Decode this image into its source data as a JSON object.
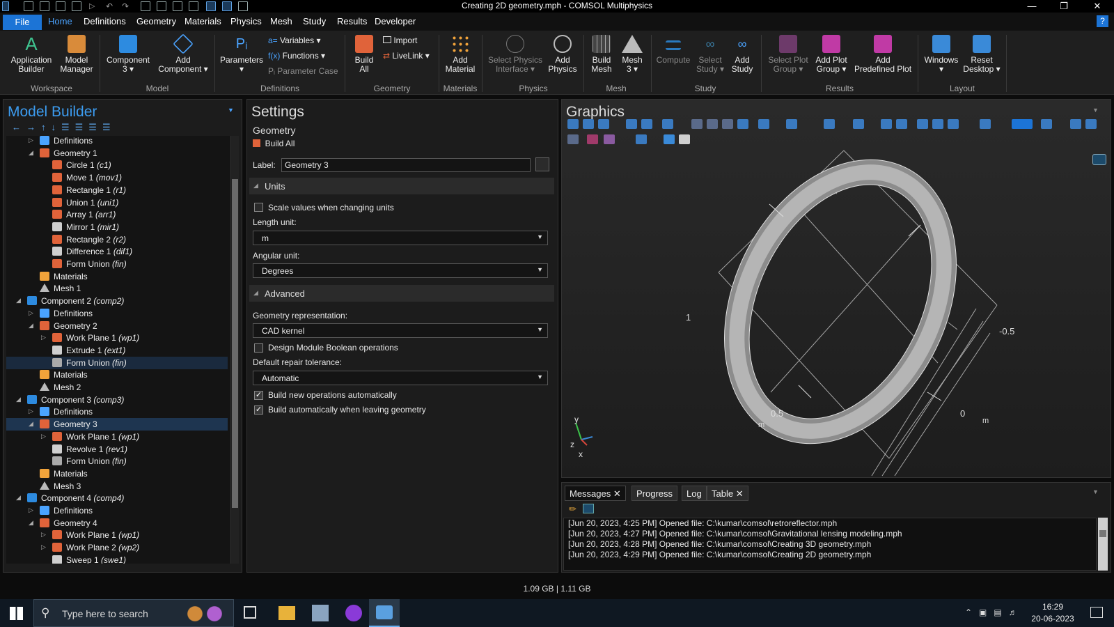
{
  "window": {
    "title": "Creating 2D geometry.mph - COMSOL Multiphysics",
    "min": "—",
    "max": "❐",
    "close": "✕"
  },
  "menu": {
    "file": "File",
    "tabs": [
      "Home",
      "Definitions",
      "Geometry",
      "Materials",
      "Physics",
      "Mesh",
      "Study",
      "Results",
      "Developer"
    ],
    "help": "?"
  },
  "ribbon": {
    "app_builder": [
      "Application",
      "Builder"
    ],
    "model_manager": [
      "Model",
      "Manager"
    ],
    "component": [
      "Component",
      "3 ▾"
    ],
    "add_component": [
      "Add",
      "Component ▾"
    ],
    "parameters": [
      "Parameters",
      "▾"
    ],
    "variables": "Variables ▾",
    "functions": "Functions ▾",
    "parameter_case": "Parameter Case",
    "build_all": [
      "Build",
      "All"
    ],
    "import": "Import",
    "livelink": "LiveLink ▾",
    "add_material": [
      "Add",
      "Material"
    ],
    "select_physics": [
      "Select Physics",
      "Interface ▾"
    ],
    "add_physics": [
      "Add",
      "Physics"
    ],
    "build_mesh": [
      "Build",
      "Mesh"
    ],
    "mesh": [
      "Mesh",
      "3 ▾"
    ],
    "compute": "Compute",
    "select_study": [
      "Select",
      "Study ▾"
    ],
    "add_study": [
      "Add",
      "Study"
    ],
    "select_plot_group": [
      "Select Plot",
      "Group ▾"
    ],
    "add_plot_group": [
      "Add Plot",
      "Group ▾"
    ],
    "add_predefined_plot": [
      "Add",
      "Predefined Plot"
    ],
    "windows": [
      "Windows",
      "▾"
    ],
    "reset_desktop": [
      "Reset",
      "Desktop ▾"
    ],
    "groups": [
      "Workspace",
      "Model",
      "Definitions",
      "Geometry",
      "Materials",
      "Physics",
      "Mesh",
      "Study",
      "Results",
      "Layout"
    ]
  },
  "model_builder": {
    "title": "Model Builder",
    "rows": [
      {
        "name": "Definitions",
        "tag": "",
        "icon": "definitions",
        "indent": 2,
        "arrow": "▷",
        "selected": false
      },
      {
        "name": "Geometry 1",
        "tag": "",
        "icon": "geometry",
        "indent": 2,
        "arrow": "◢",
        "selected": false
      },
      {
        "name": "Circle 1",
        "tag": "(c1)",
        "icon": "circle",
        "indent": 3,
        "arrow": "",
        "selected": false
      },
      {
        "name": "Move 1",
        "tag": "(mov1)",
        "icon": "move",
        "indent": 3,
        "arrow": "",
        "selected": false
      },
      {
        "name": "Rectangle 1",
        "tag": "(r1)",
        "icon": "rectangle",
        "indent": 3,
        "arrow": "",
        "selected": false
      },
      {
        "name": "Union 1",
        "tag": "(uni1)",
        "icon": "union",
        "indent": 3,
        "arrow": "",
        "selected": false
      },
      {
        "name": "Array 1",
        "tag": "(arr1)",
        "icon": "array",
        "indent": 3,
        "arrow": "",
        "selected": false
      },
      {
        "name": "Mirror 1",
        "tag": "(mir1)",
        "icon": "mirror",
        "indent": 3,
        "arrow": "",
        "selected": false
      },
      {
        "name": "Rectangle 2",
        "tag": "(r2)",
        "icon": "rectangle",
        "indent": 3,
        "arrow": "",
        "selected": false
      },
      {
        "name": "Difference 1",
        "tag": "(dif1)",
        "icon": "difference",
        "indent": 3,
        "arrow": "",
        "selected": false
      },
      {
        "name": "Form Union",
        "tag": "(fin)",
        "icon": "formunion",
        "indent": 3,
        "arrow": "",
        "selected": false
      },
      {
        "name": "Materials",
        "tag": "",
        "icon": "materials",
        "indent": 2,
        "arrow": "",
        "selected": false
      },
      {
        "name": "Mesh 1",
        "tag": "",
        "icon": "mesh",
        "indent": 2,
        "arrow": "",
        "selected": false
      },
      {
        "name": "Component 2",
        "tag": "(comp2)",
        "icon": "component",
        "indent": 1,
        "arrow": "◢",
        "selected": false
      },
      {
        "name": "Definitions",
        "tag": "",
        "icon": "definitions",
        "indent": 2,
        "arrow": "▷",
        "selected": false
      },
      {
        "name": "Geometry 2",
        "tag": "",
        "icon": "geometry",
        "indent": 2,
        "arrow": "◢",
        "selected": false
      },
      {
        "name": "Work Plane 1",
        "tag": "(wp1)",
        "icon": "workplane",
        "indent": 3,
        "arrow": "▷",
        "selected": false
      },
      {
        "name": "Extrude 1",
        "tag": "(ext1)",
        "icon": "extrude",
        "indent": 3,
        "arrow": "",
        "selected": false
      },
      {
        "name": "Form Union",
        "tag": "(fin)",
        "icon": "formunion-gray",
        "indent": 3,
        "arrow": "",
        "selected": "light"
      },
      {
        "name": "Materials",
        "tag": "",
        "icon": "materials",
        "indent": 2,
        "arrow": "",
        "selected": false
      },
      {
        "name": "Mesh 2",
        "tag": "",
        "icon": "mesh",
        "indent": 2,
        "arrow": "",
        "selected": false
      },
      {
        "name": "Component 3",
        "tag": "(comp3)",
        "icon": "component",
        "indent": 1,
        "arrow": "◢",
        "selected": false
      },
      {
        "name": "Definitions",
        "tag": "",
        "icon": "definitions",
        "indent": 2,
        "arrow": "▷",
        "selected": false
      },
      {
        "name": "Geometry 3",
        "tag": "",
        "icon": "geometry",
        "indent": 2,
        "arrow": "◢",
        "selected": true
      },
      {
        "name": "Work Plane 1",
        "tag": "(wp1)",
        "icon": "workplane",
        "indent": 3,
        "arrow": "▷",
        "selected": false
      },
      {
        "name": "Revolve 1",
        "tag": "(rev1)",
        "icon": "revolve",
        "indent": 3,
        "arrow": "",
        "selected": false
      },
      {
        "name": "Form Union",
        "tag": "(fin)",
        "icon": "formunion-gray",
        "indent": 3,
        "arrow": "",
        "selected": false
      },
      {
        "name": "Materials",
        "tag": "",
        "icon": "materials",
        "indent": 2,
        "arrow": "",
        "selected": false
      },
      {
        "name": "Mesh 3",
        "tag": "",
        "icon": "mesh",
        "indent": 2,
        "arrow": "",
        "selected": false
      },
      {
        "name": "Component 4",
        "tag": "(comp4)",
        "icon": "component",
        "indent": 1,
        "arrow": "◢",
        "selected": false
      },
      {
        "name": "Definitions",
        "tag": "",
        "icon": "definitions",
        "indent": 2,
        "arrow": "▷",
        "selected": false
      },
      {
        "name": "Geometry 4",
        "tag": "",
        "icon": "geometry",
        "indent": 2,
        "arrow": "◢",
        "selected": false
      },
      {
        "name": "Work Plane 1",
        "tag": "(wp1)",
        "icon": "workplane",
        "indent": 3,
        "arrow": "▷",
        "selected": false
      },
      {
        "name": "Work Plane 2",
        "tag": "(wp2)",
        "icon": "workplane",
        "indent": 3,
        "arrow": "▷",
        "selected": false
      },
      {
        "name": "Sweep 1",
        "tag": "(swe1)",
        "icon": "sweep",
        "indent": 3,
        "arrow": "",
        "selected": false
      }
    ]
  },
  "settings": {
    "title": "Settings",
    "subtitle": "Geometry",
    "build_all": "Build All",
    "label_caption": "Label:",
    "label_value": "Geometry 3",
    "units_section": "Units",
    "scale_values": "Scale values when changing units",
    "length_unit_caption": "Length unit:",
    "length_unit": "m",
    "angular_unit_caption": "Angular unit:",
    "angular_unit": "Degrees",
    "advanced_section": "Advanced",
    "geom_rep_caption": "Geometry representation:",
    "geom_rep": "CAD kernel",
    "design_module": "Design Module Boolean operations",
    "repair_caption": "Default repair tolerance:",
    "repair": "Automatic",
    "build_new_ops": "Build new operations automatically",
    "build_leaving": "Build automatically when leaving geometry",
    "checks": {
      "scale_values": false,
      "design_module": false,
      "build_new_ops": true,
      "build_leaving": true
    }
  },
  "graphics": {
    "title": "Graphics",
    "axis_labels": {
      "one": "1",
      "neg_half": "-0.5",
      "half": "0.5",
      "zero": "0",
      "m_left": "m",
      "m_right": "m"
    },
    "triad": {
      "y": "y",
      "z": "z",
      "x": "x"
    }
  },
  "messages": {
    "tabs": [
      "Messages",
      "Progress",
      "Log",
      "Table"
    ],
    "close": "✕",
    "lines": [
      "[Jun 20, 2023, 4:25 PM] Opened file: C:\\kumar\\comsol\\retroreflector.mph",
      "[Jun 20, 2023, 4:27 PM] Opened file: C:\\kumar\\comsol\\Gravitational lensing modeling.mph",
      "[Jun 20, 2023, 4:28 PM] Opened file: C:\\kumar\\comsol\\Creating 3D geometry.mph",
      "[Jun 20, 2023, 4:29 PM] Opened file: C:\\kumar\\comsol\\Creating 2D geometry.mph"
    ]
  },
  "status": {
    "memory": "1.09 GB | 1.11 GB"
  },
  "taskbar": {
    "search_placeholder": "Type here to search",
    "time": "16:29",
    "date": "20-06-2023"
  }
}
